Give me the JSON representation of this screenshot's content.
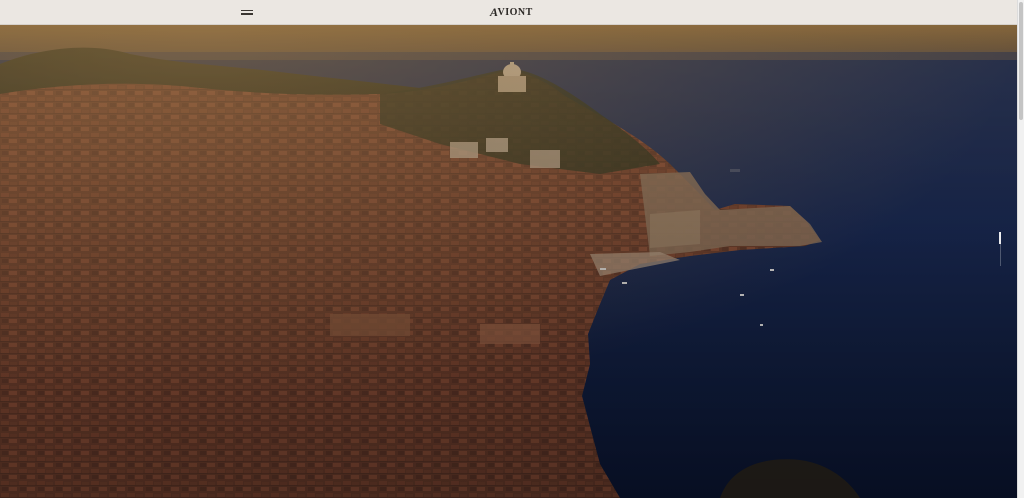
{
  "header": {
    "brand_text": "VIONT",
    "brand_initial": "A",
    "menu_icon": "hamburger-icon"
  },
  "hero": {
    "description_icon": "aerial-coastal-town-image"
  },
  "colors": {
    "header_bg": "#ebe7e2",
    "sky_top": "#8b6b3f",
    "sea_deep": "#0e1b3e",
    "roofs": "#8a4a33"
  },
  "scroll_indicator": {
    "progress": 0.0
  }
}
